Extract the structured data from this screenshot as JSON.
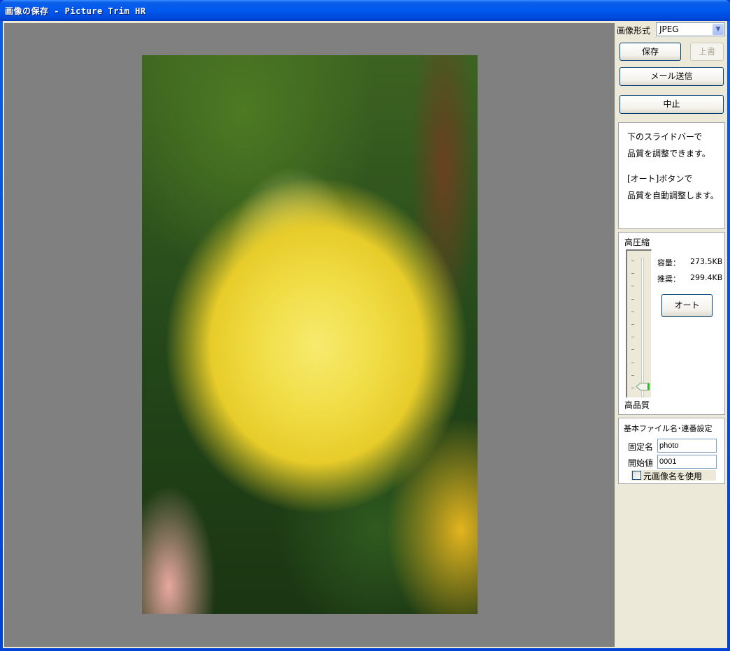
{
  "window": {
    "title": "画像の保存 - Picture Trim HR"
  },
  "format": {
    "label": "画像形式",
    "selected": "JPEG"
  },
  "buttons": {
    "save": "保存",
    "overwrite": "上書",
    "mail": "メール送信",
    "cancel": "中止",
    "auto": "オート"
  },
  "info": {
    "line1": "下のスライドバーで",
    "line2": "品質を調整できます。",
    "line3": "[オート]ボタンで",
    "line4": "品質を自動調整します。"
  },
  "quality": {
    "top_label": "高圧縮",
    "bottom_label": "高品質",
    "slider_value_fraction_from_top": 1.0,
    "tick_count": 11,
    "size_label": "容量：",
    "size_value": "273.5KB",
    "recommended_label": "推奨：",
    "recommended_value": "299.4KB"
  },
  "filename": {
    "title": "基本ファイル名･連番設定",
    "fixed_label": "固定名",
    "fixed_value": "photo",
    "start_label": "開始値",
    "start_value": "0001",
    "use_original_label": "元画像名を使用",
    "use_original_checked": false
  },
  "preview": {
    "description": "yellow rose photo"
  }
}
